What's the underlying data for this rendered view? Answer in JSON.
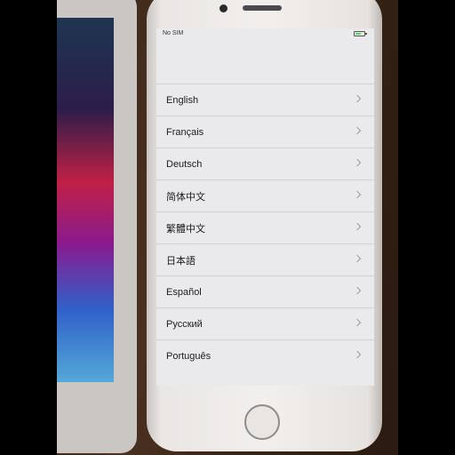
{
  "status_bar": {
    "carrier": "No SIM"
  },
  "languages": [
    "English",
    "Français",
    "Deutsch",
    "简体中文",
    "繁體中文",
    "日本語",
    "Español",
    "Русский",
    "Português"
  ],
  "colors": {
    "screen_background": "#eae9ec",
    "phone_body": "#f2efed",
    "table_background": "#4a3020",
    "battery_fill": "#4cd964"
  },
  "icons": [
    "chevron-right-icon",
    "battery-icon",
    "home-button"
  ]
}
